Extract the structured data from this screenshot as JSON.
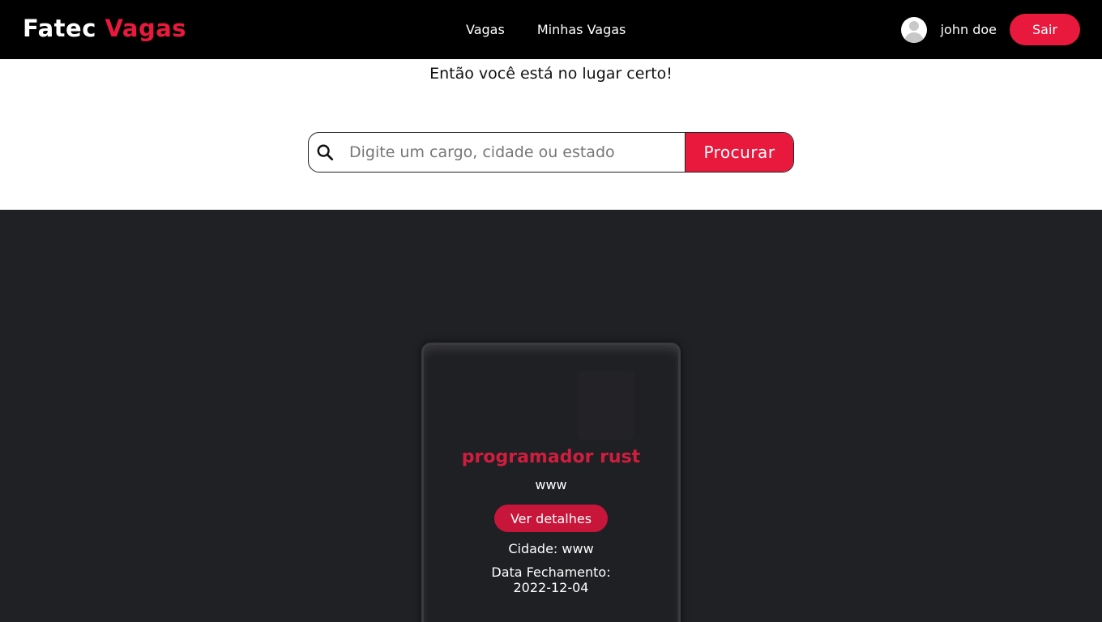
{
  "navbar": {
    "brand_prefix": "Fatec",
    "brand_accent": "Vagas",
    "links": [
      {
        "label": "Vagas"
      },
      {
        "label": "Minhas Vagas"
      }
    ],
    "user_name": "john doe",
    "logout_label": "Sair"
  },
  "hero": {
    "subtitle": "Então você está no lugar certo!"
  },
  "search": {
    "icon": "search-icon",
    "placeholder": "Digite um cargo, cidade ou estado",
    "value": "",
    "button_label": "Procurar"
  },
  "job_card": {
    "title": "programador rust",
    "company": "www",
    "details_label": "Ver detalhes",
    "city_text": "Cidade: www",
    "date_label": "Data Fechamento:",
    "date_value": "2022-12-04"
  },
  "colors": {
    "accent": "#e8193c",
    "navbar_bg": "#000000",
    "dark_bg": "#202125",
    "card_title": "#d11d3d"
  }
}
